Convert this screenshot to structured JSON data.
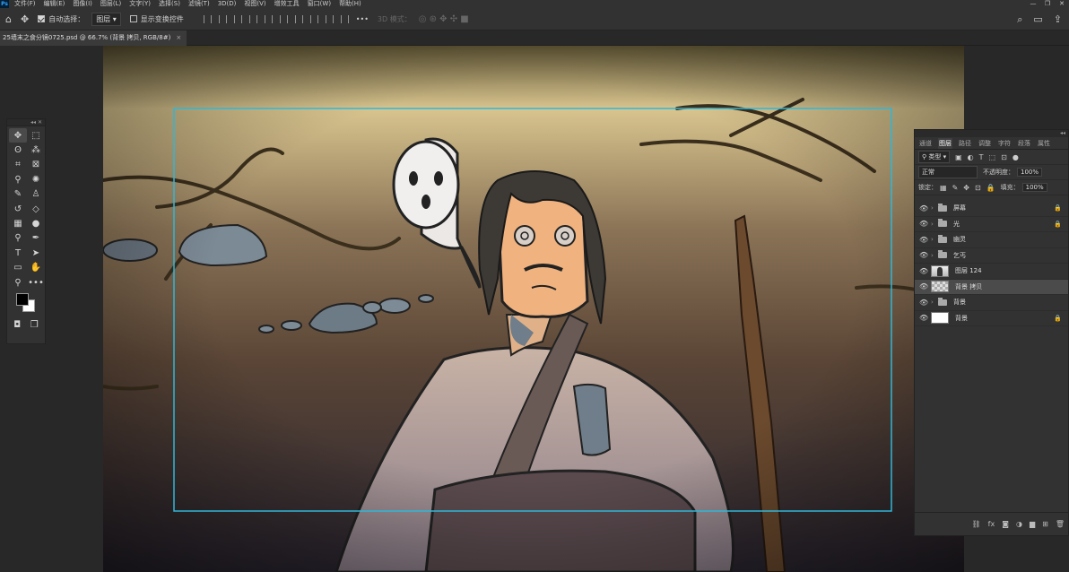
{
  "menubar": {
    "logo": "Ps",
    "items": [
      "文件(F)",
      "编辑(E)",
      "图像(I)",
      "图层(L)",
      "文字(Y)",
      "选择(S)",
      "滤镜(T)",
      "3D(D)",
      "视图(V)",
      "增效工具",
      "窗口(W)",
      "帮助(H)"
    ],
    "window_controls": [
      "—",
      "❐",
      "✕"
    ]
  },
  "options": {
    "home_icon": "⌂",
    "move_icon": "✥",
    "auto_select_label": "自动选择：",
    "auto_select_value": "图层",
    "show_transform_label": "显示变换控件",
    "more_icon": "•••",
    "mode_3d_label": "3D 模式：",
    "search_icon": "⌕",
    "workspace_icon": "▭",
    "share_icon": "⇪"
  },
  "document": {
    "tab_title": "25墙末之食分镜0725.psd @ 66.7% (背景 拷贝, RGB/8#)",
    "close_label": "×"
  },
  "toolbox": {
    "collapse_label": "◂◂  ✕",
    "tools": [
      {
        "name": "move-tool",
        "icon": "✥"
      },
      {
        "name": "marquee-tool",
        "icon": "⬚"
      },
      {
        "name": "lasso-tool",
        "icon": "ʘ"
      },
      {
        "name": "magic-wand-tool",
        "icon": "⁂"
      },
      {
        "name": "crop-tool",
        "icon": "⌗"
      },
      {
        "name": "frame-tool",
        "icon": "⊠"
      },
      {
        "name": "eyedropper-tool",
        "icon": "⚲"
      },
      {
        "name": "spot-healing-tool",
        "icon": "✺"
      },
      {
        "name": "brush-tool",
        "icon": "✎"
      },
      {
        "name": "stamp-tool",
        "icon": "♙"
      },
      {
        "name": "history-brush-tool",
        "icon": "↺"
      },
      {
        "name": "eraser-tool",
        "icon": "◇"
      },
      {
        "name": "gradient-tool",
        "icon": "▦"
      },
      {
        "name": "blur-tool",
        "icon": "●"
      },
      {
        "name": "dodge-tool",
        "icon": "⚲"
      },
      {
        "name": "pen-tool",
        "icon": "✒"
      },
      {
        "name": "type-tool",
        "icon": "T"
      },
      {
        "name": "path-select-tool",
        "icon": "➤"
      },
      {
        "name": "shape-tool",
        "icon": "▭"
      },
      {
        "name": "hand-tool",
        "icon": "✋"
      },
      {
        "name": "zoom-tool",
        "icon": "⚲"
      },
      {
        "name": "more-tools",
        "icon": "•••"
      }
    ],
    "quick_mask_icon": "◘",
    "screen_mode_icon": "❐",
    "colors": {
      "foreground": "#000000",
      "background": "#ffffff"
    }
  },
  "layers_panel": {
    "collapse_label": "◂◂",
    "tabs": [
      "通道",
      "图层",
      "路径",
      "调整",
      "字符",
      "段落",
      "属性"
    ],
    "active_tab": "图层",
    "filter_label": "类型",
    "filter_icons": [
      "▣",
      "◐",
      "T",
      "⬚",
      "⊡",
      "●"
    ],
    "blend_mode": "正常",
    "opacity_label": "不透明度：",
    "opacity_value": "100%",
    "lock_label": "锁定：",
    "lock_icons": [
      "▦",
      "✎",
      "✥",
      "⊡",
      "🔒"
    ],
    "fill_label": "填充：",
    "fill_value": "100%",
    "layers": [
      {
        "name": "屏幕",
        "type": "group",
        "locked": true
      },
      {
        "name": "光",
        "type": "group",
        "locked": true
      },
      {
        "name": "幽灵",
        "type": "group",
        "locked": false
      },
      {
        "name": "乞丐",
        "type": "group",
        "locked": false
      },
      {
        "name": "图层 124",
        "type": "pixel",
        "locked": false
      },
      {
        "name": "背景 拷贝",
        "type": "pixel",
        "locked": false,
        "selected": true
      },
      {
        "name": "背景",
        "type": "group",
        "locked": false
      },
      {
        "name": "背景",
        "type": "background",
        "locked": true
      }
    ],
    "footer_icons": [
      "⛓",
      "fx",
      "◙",
      "◑",
      "▆",
      "⊞",
      "🗑"
    ]
  }
}
